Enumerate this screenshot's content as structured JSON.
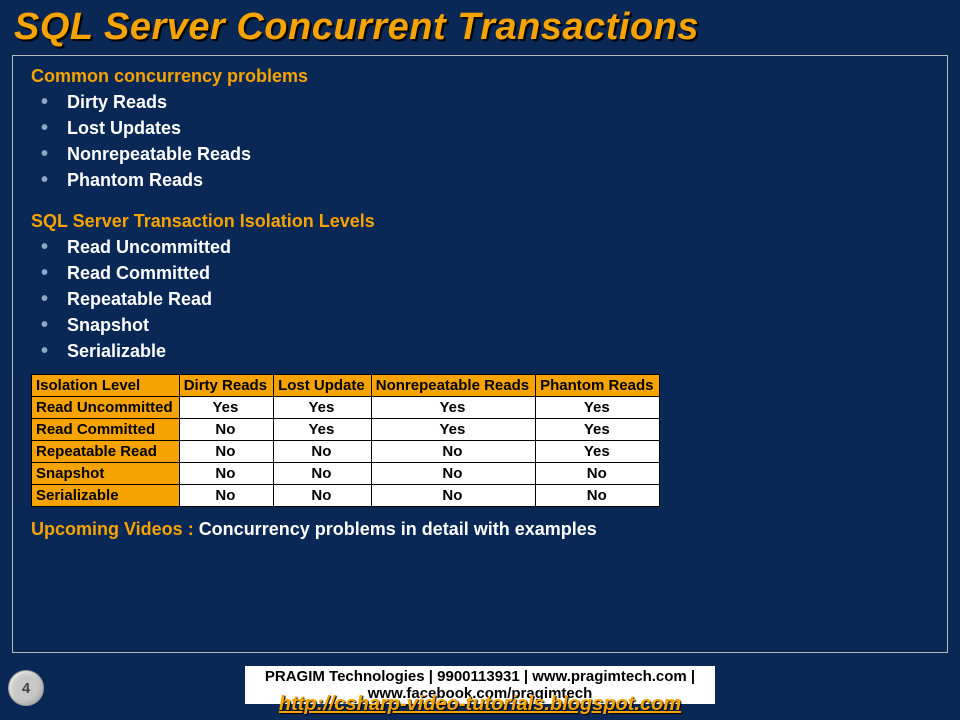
{
  "title": "SQL Server Concurrent Transactions",
  "section1": {
    "heading": "Common concurrency problems",
    "items": [
      "Dirty Reads",
      "Lost Updates",
      "Nonrepeatable Reads",
      "Phantom Reads"
    ]
  },
  "section2": {
    "heading": "SQL Server Transaction Isolation Levels",
    "items": [
      "Read Uncommitted",
      "Read Committed",
      "Repeatable Read",
      "Snapshot",
      "Serializable"
    ]
  },
  "table": {
    "headers": [
      "Isolation Level",
      "Dirty Reads",
      "Lost Update",
      "Nonrepeatable Reads",
      "Phantom Reads"
    ],
    "rows": [
      [
        "Read Uncommitted",
        "Yes",
        "Yes",
        "Yes",
        "Yes"
      ],
      [
        "Read Committed",
        "No",
        "Yes",
        "Yes",
        "Yes"
      ],
      [
        "Repeatable Read",
        "No",
        "No",
        "No",
        "Yes"
      ],
      [
        "Snapshot",
        "No",
        "No",
        "No",
        "No"
      ],
      [
        "Serializable",
        "No",
        "No",
        "No",
        "No"
      ]
    ]
  },
  "upcoming": {
    "label": "Upcoming Videos : ",
    "text": "Concurrency problems in detail with examples"
  },
  "footer": {
    "page": "4",
    "credits": "PRAGIM Technologies | 9900113931 | www.pragimtech.com | www.facebook.com/pragimtech",
    "link": "http://csharp-video-tutorials.blogspot.com"
  }
}
